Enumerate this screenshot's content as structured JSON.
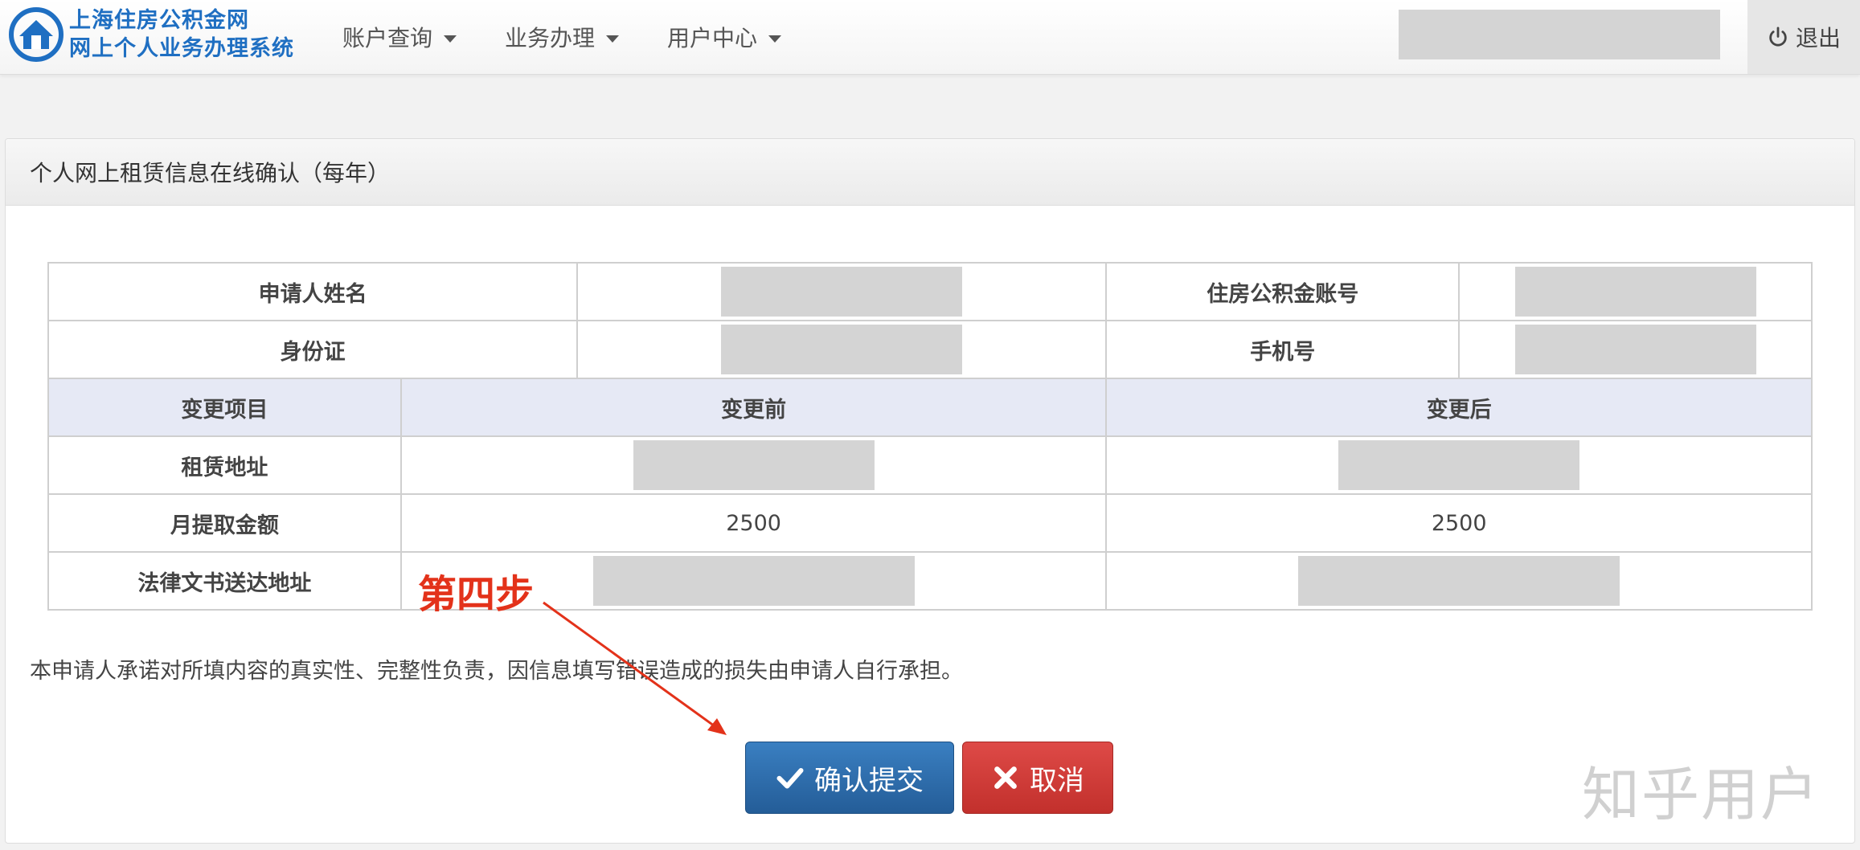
{
  "header": {
    "logo_line1": "上海住房公积金网",
    "logo_line2": "网上个人业务办理系统",
    "nav": [
      "账户查询",
      "业务办理",
      "用户中心"
    ],
    "logout": "退出"
  },
  "panel": {
    "title": "个人网上租赁信息在线确认（每年）"
  },
  "table": {
    "applicant_name_label": "申请人姓名",
    "fund_account_label": "住房公积金账号",
    "id_card_label": "身份证",
    "phone_label": "手机号",
    "col_item": "变更项目",
    "col_before": "变更前",
    "col_after": "变更后",
    "rows": [
      {
        "label": "租赁地址",
        "before": "",
        "after": ""
      },
      {
        "label": "月提取金额",
        "before": "2500",
        "after": "2500"
      },
      {
        "label": "法律文书送达地址",
        "before": "",
        "after": ""
      }
    ]
  },
  "notice": "本申请人承诺对所填内容的真实性、完整性负责，因信息填写错误造成的损失由申请人自行承担。",
  "buttons": {
    "confirm": "确认提交",
    "cancel": "取消"
  },
  "annotation": "第四步",
  "watermark": "知乎用户",
  "colors": {
    "brand_blue": "#1f6fc2",
    "confirm_button": "#2e6eae",
    "cancel_button": "#d23f3b",
    "annotation_red": "#e3321a",
    "table_header_bg": "#e6e9f5"
  }
}
